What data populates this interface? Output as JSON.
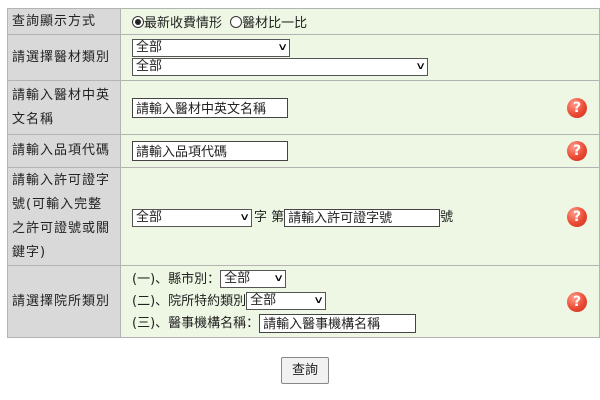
{
  "rows": {
    "display_mode": {
      "label": "查詢顯示方式",
      "option_latest": "最新收費情形",
      "option_compare": "醫材比一比",
      "selected": "最新收費情形"
    },
    "category": {
      "label": "請選擇醫材類別",
      "select1": "全部",
      "select2": "全部"
    },
    "name": {
      "label": "請輸入醫材中英文名稱",
      "placeholder": "請輸入醫材中英文名稱"
    },
    "code": {
      "label": "請輸入品項代碼",
      "placeholder": "請輸入品項代碼"
    },
    "license": {
      "label": "請輸入許可證字號(可輸入完整之許可證號或關鍵字)",
      "select": "全部",
      "zi": "字",
      "di": "第",
      "placeholder": "請輸入許可證字號",
      "hao": "號"
    },
    "hospital": {
      "label": "請選擇院所類別",
      "county_label": "(一)、縣市別：",
      "county_value": "全部",
      "contract_label": "(二)、院所特約類別",
      "contract_value": "全部",
      "org_label": "(三)、醫事機構名稱：",
      "org_placeholder": "請輸入醫事機構名稱"
    }
  },
  "help_glyph": "?",
  "help_icon": "question-help-icon",
  "query_button": "查詢"
}
